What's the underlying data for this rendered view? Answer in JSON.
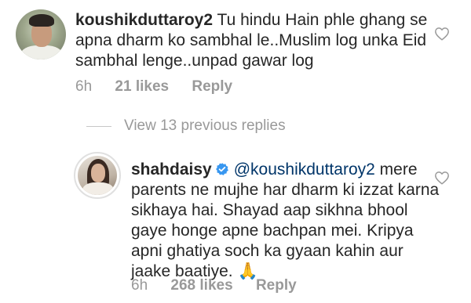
{
  "comments": [
    {
      "username": "koushikduttaroy2",
      "text": "Tu hindu Hain phle ghang se apna dharm ko sambhal le..Muslim log unka Eid sambhal lenge..unpad gawar log",
      "time": "6h",
      "likes": "21 likes",
      "reply": "Reply"
    },
    {
      "username": "shahdaisy",
      "mention": "@koushikduttaroy2",
      "text": "mere parents ne mujhe har dharm ki izzat karna sikhaya hai. Shayad aap sikhna bhool gaye honge apne bachpan mei. Kripya apni ghatiya soch ka gyaan kahin aur jaake baatiye.",
      "emoji": "🙏",
      "time": "6h",
      "likes": "268 likes",
      "reply": "Reply"
    }
  ],
  "view_replies": "View 13 previous replies",
  "colors": {
    "text": "#262626",
    "meta": "#999999",
    "mention": "#003569",
    "verified": "#3897f0"
  }
}
